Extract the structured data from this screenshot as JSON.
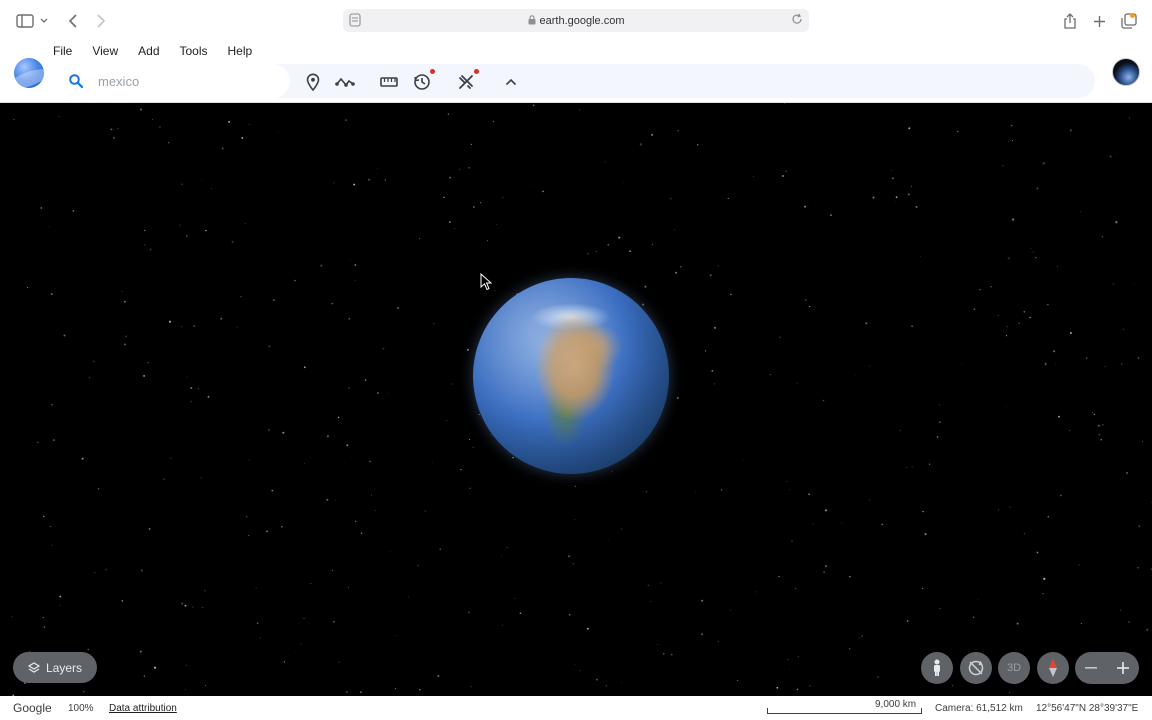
{
  "browser": {
    "url": "earth.google.com"
  },
  "menu": {
    "items": [
      {
        "label": "File"
      },
      {
        "label": "View"
      },
      {
        "label": "Add"
      },
      {
        "label": "Tools"
      },
      {
        "label": "Help"
      }
    ]
  },
  "search": {
    "placeholder": "mexico",
    "value": ""
  },
  "toolbar": {
    "tools": [
      {
        "icon": "placemark-icon"
      },
      {
        "icon": "path-icon"
      },
      {
        "icon": "ruler-icon"
      },
      {
        "icon": "history-icon"
      },
      {
        "icon": "projects-icon"
      },
      {
        "icon": "chevron-up-icon"
      }
    ]
  },
  "map": {
    "layers_label": "Layers",
    "view_3d_label": "3D"
  },
  "status": {
    "brand": "Google",
    "zoom": "100%",
    "attribution": "Data attribution",
    "scale": "9,000 km",
    "camera": "Camera: 61,512 km",
    "coordinates": "12°56'47\"N 28°39'37\"E"
  },
  "colors": {
    "accent": "#1a73e8",
    "notify": "#d93025",
    "control_bg": "#5f6368"
  }
}
